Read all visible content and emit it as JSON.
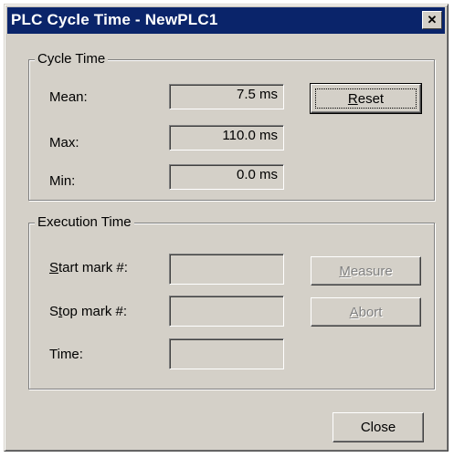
{
  "window": {
    "title": "PLC Cycle Time - NewPLC1",
    "close_glyph": "✕"
  },
  "cycle_time": {
    "legend": "Cycle Time",
    "mean_label": "Mean:",
    "max_label": "Max:",
    "min_label": "Min:",
    "mean_value": "7.5 ms",
    "max_value": "110.0 ms",
    "min_value": "0.0 ms",
    "reset_accel": "R",
    "reset_rest": "eset"
  },
  "execution_time": {
    "legend": "Execution Time",
    "start_accel": "S",
    "start_rest": "tart mark #:",
    "stop_pre": "S",
    "stop_accel": "t",
    "stop_rest": "op mark #:",
    "time_label": "Time:",
    "start_value": "",
    "stop_value": "",
    "time_value": "",
    "measure_accel": "M",
    "measure_rest": "easure",
    "abort_accel": "A",
    "abort_rest": "bort"
  },
  "footer": {
    "close_label": "Close"
  }
}
